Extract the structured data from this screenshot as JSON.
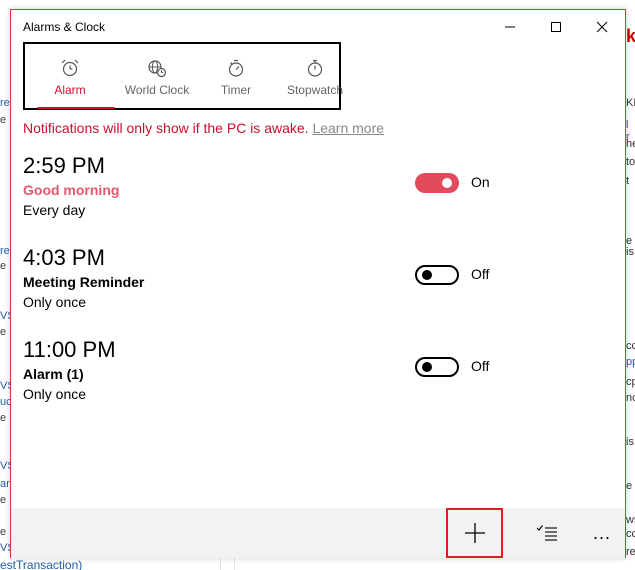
{
  "window": {
    "title": "Alarms & Clock"
  },
  "tabs": [
    {
      "label": "Alarm",
      "icon": "alarm-clock-icon",
      "active": true
    },
    {
      "label": "World Clock",
      "icon": "world-clock-icon",
      "active": false
    },
    {
      "label": "Timer",
      "icon": "timer-icon",
      "active": false
    },
    {
      "label": "Stopwatch",
      "icon": "stopwatch-icon",
      "active": false
    }
  ],
  "notice": {
    "text": "Notifications will only show if the PC is awake.",
    "link": "Learn more"
  },
  "alarms": [
    {
      "time": "2:59 PM",
      "name": "Good morning",
      "repeat": "Every day",
      "enabled": true,
      "state_label": "On"
    },
    {
      "time": "4:03 PM",
      "name": "Meeting Reminder",
      "repeat": "Only once",
      "enabled": false,
      "state_label": "Off"
    },
    {
      "time": "11:00 PM",
      "name": "Alarm (1)",
      "repeat": "Only once",
      "enabled": false,
      "state_label": "Off"
    }
  ],
  "bottombar": {
    "add_icon": "plus-icon",
    "select_icon": "checklist-icon",
    "more_label": "..."
  },
  "background": {
    "left_fragments": [
      "re",
      "e",
      "re",
      "e",
      "VS",
      "e",
      "VS",
      "uc",
      "e",
      "VS",
      "an",
      "e",
      "VS",
      "e"
    ],
    "right_fragments": [
      "k",
      "KE",
      "l r",
      "he",
      "to",
      "t",
      "e",
      "is",
      "cc",
      "pp",
      "cp",
      "nc",
      "is",
      "e",
      "ws",
      "cc",
      "re"
    ],
    "bottom_text": "estTransaction)"
  },
  "colors": {
    "accent": "#c8102e",
    "toggle_on": "#e04b5e",
    "highlight_border": "#e11d1d"
  }
}
